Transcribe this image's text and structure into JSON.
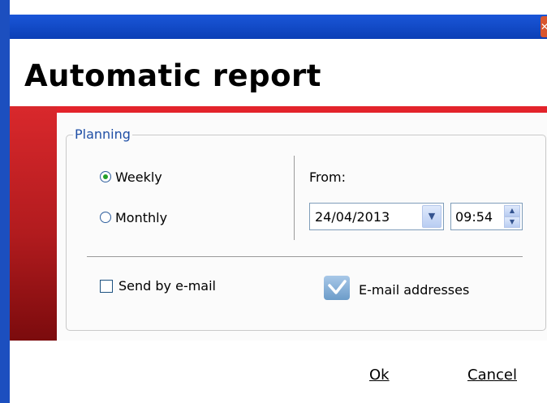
{
  "window": {
    "title": "Automatic report"
  },
  "planning": {
    "legend": "Planning",
    "frequency_options": [
      {
        "label": "Weekly",
        "selected": true
      },
      {
        "label": "Monthly",
        "selected": false
      }
    ],
    "from_label": "From:",
    "date_value": "24/04/2013",
    "time_value": "09:54"
  },
  "email": {
    "send_label": "Send by e-mail",
    "send_checked": false,
    "addresses_label": "E-mail addresses"
  },
  "buttons": {
    "ok": "Ok",
    "cancel": "Cancel"
  },
  "colors": {
    "accent_red": "#e3232b",
    "titlebar_blue": "#0b3fb6",
    "legend_blue": "#1f4fa6",
    "radio_green": "#23a029"
  }
}
